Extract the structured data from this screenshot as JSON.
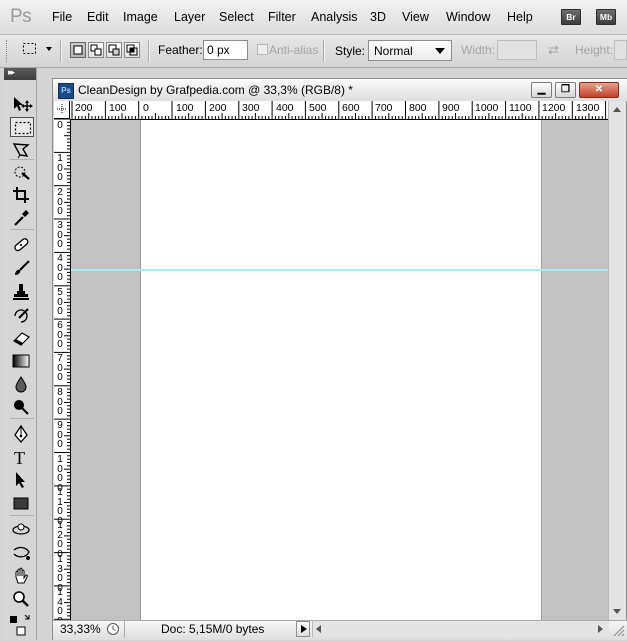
{
  "app": {
    "logo": "Ps",
    "menus": [
      "File",
      "Edit",
      "Image",
      "Layer",
      "Select",
      "Filter",
      "Analysis",
      "3D",
      "View",
      "Window",
      "Help"
    ],
    "bridge_badge": "Br",
    "minibridge_badge": "Mb"
  },
  "options": {
    "feather_label": "Feather:",
    "feather_value": "0 px",
    "antialias_label": "Anti-alias",
    "style_label": "Style:",
    "style_value": "Normal",
    "width_label": "Width:",
    "height_label": "Height:"
  },
  "document": {
    "title": "CleanDesign by Grafpedia.com @ 33,3% (RGB/8) *",
    "ps_icon": "Ps",
    "hruler_labels": [
      "200",
      "100",
      "0",
      "100",
      "200",
      "300",
      "400",
      "500",
      "600",
      "700",
      "800",
      "900",
      "1000",
      "1100",
      "1200",
      "1300"
    ],
    "vruler_labels": [
      "0",
      "100",
      "200",
      "300",
      "400",
      "500",
      "600",
      "700",
      "800",
      "900",
      "1000",
      "1100",
      "1200",
      "1300",
      "1400"
    ],
    "guide_color": "#9ff0f0"
  },
  "status": {
    "zoom": "33,33%",
    "doc_info": "Doc: 5,15M/0 bytes"
  },
  "tools": [
    "move-tool",
    "rectangular-marquee-tool",
    "lasso-tool",
    "quick-selection-tool",
    "crop-tool",
    "eyedropper-tool",
    "spot-healing-brush-tool",
    "brush-tool",
    "clone-stamp-tool",
    "history-brush-tool",
    "eraser-tool",
    "gradient-tool",
    "blur-tool",
    "dodge-tool",
    "pen-tool",
    "type-tool",
    "path-selection-tool",
    "rectangle-tool",
    "3d-rotate-tool",
    "3d-orbit-tool",
    "hand-tool",
    "zoom-tool",
    "color-swatches"
  ]
}
